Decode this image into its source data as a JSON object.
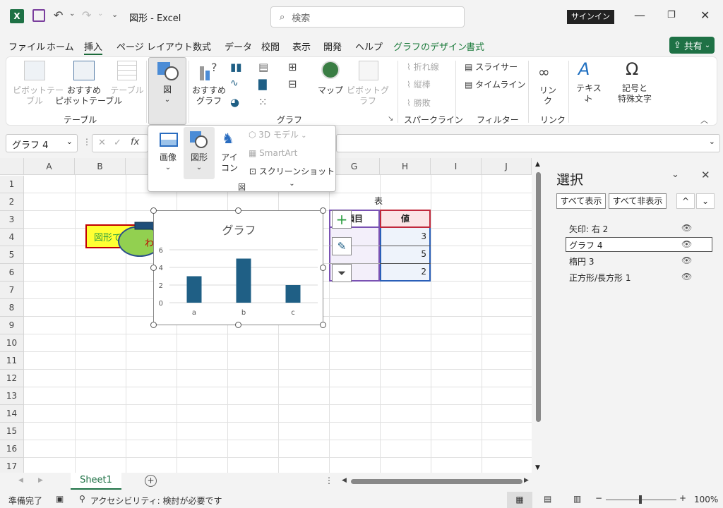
{
  "app": {
    "title": "図形 - Excel",
    "search_placeholder": "検索",
    "signin": "サインイン",
    "share": "共有"
  },
  "menu": [
    "ファイル",
    "ホーム",
    "挿入",
    "ページ レイアウト",
    "数式",
    "データ",
    "校閲",
    "表示",
    "開発",
    "ヘルプ",
    "グラフのデザイン",
    "書式"
  ],
  "ribbon": {
    "pivot": "ピボットテー\nブル",
    "rec_pivot": "おすすめ\nピボットテーブル",
    "table": "テーブル",
    "illust": "図",
    "rec_chart": "おすすめ\nグラフ",
    "map": "マップ",
    "pivot_chart": "ピボットグラフ",
    "spark_line": "折れ線",
    "spark_col": "縦棒",
    "spark_wl": "勝敗",
    "slicer": "スライサー",
    "timeline": "タイムライン",
    "link": "リン\nク",
    "text": "テキスト",
    "symbol": "記号と\n特殊文字",
    "groups": {
      "table": "テーブル",
      "chart": "グラフ",
      "spark": "スパークライン",
      "filter": "フィルター",
      "link": "リンク"
    }
  },
  "dropdown": {
    "image": "画像",
    "shapes": "図形",
    "icon": "アイ\nコン",
    "model3d": "3D モデル",
    "smartart": "SmartArt",
    "screenshot": "スクリーンショット",
    "footer": "図"
  },
  "namebox": "グラフ 4",
  "columns": [
    "A",
    "B",
    "C",
    "D",
    "E",
    "F",
    "G",
    "H",
    "I",
    "J"
  ],
  "rows": [
    "1",
    "2",
    "3",
    "4",
    "5",
    "6",
    "7",
    "8",
    "9",
    "10",
    "11",
    "12",
    "13",
    "14",
    "15",
    "16",
    "17"
  ],
  "sheet": {
    "shape_text": "図形で",
    "ellipse_text": "わ",
    "table_title": "表",
    "table_headers": [
      "項目",
      "値"
    ],
    "table_values": [
      "3",
      "5",
      "2"
    ]
  },
  "chart_data": {
    "type": "bar",
    "title": "グラフ",
    "categories": [
      "a",
      "b",
      "c"
    ],
    "values": [
      3,
      5,
      2
    ],
    "ylim": [
      0,
      6
    ],
    "yticks": [
      "0",
      "2",
      "4",
      "6"
    ],
    "color": "#1f5f85"
  },
  "pane": {
    "title": "選択",
    "show_all": "すべて表示",
    "hide_all": "すべて非表示",
    "items": [
      "矢印: 右 2",
      "グラフ 4",
      "楕円 3",
      "正方形/長方形 1"
    ]
  },
  "tabs": {
    "sheet1": "Sheet1"
  },
  "status": {
    "ready": "準備完了",
    "access": "アクセシビリティ: 検討が必要です",
    "zoom": "100%"
  }
}
